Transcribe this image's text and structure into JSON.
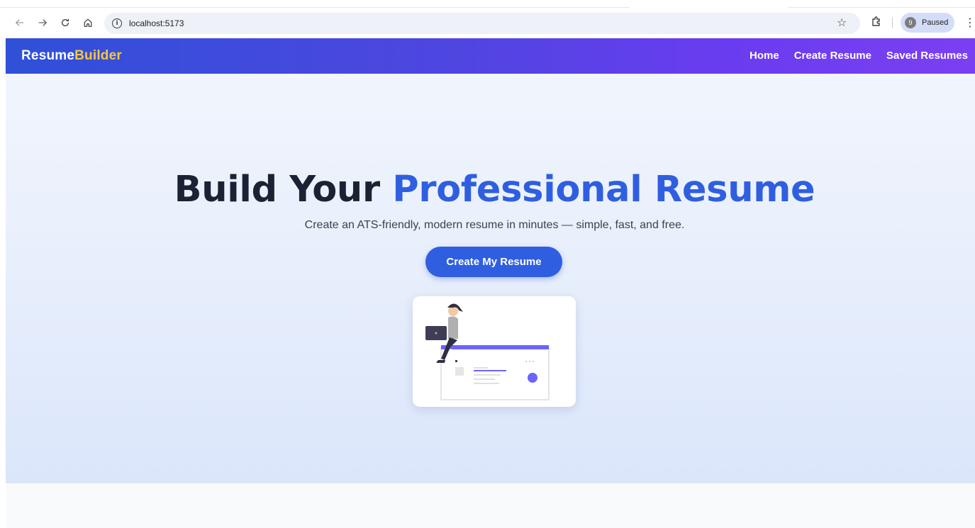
{
  "browser": {
    "url": "localhost:5173",
    "profile_label": "Paused",
    "profile_initial": "9"
  },
  "header": {
    "brand_part1": "Resume",
    "brand_part2": "Builder",
    "nav": [
      {
        "label": "Home"
      },
      {
        "label": "Create Resume"
      },
      {
        "label": "Saved Resumes"
      }
    ]
  },
  "hero": {
    "title_part1": "Build Your ",
    "title_accent": "Professional Resume",
    "subtitle": "Create an ATS-friendly, modern resume in minutes — simple, fast, and free.",
    "cta_label": "Create My Resume"
  },
  "colors": {
    "brand_accent": "#f5c842",
    "primary": "#2f5fe0",
    "header_gradient_start": "#2f50d8",
    "header_gradient_end": "#7b3ff2"
  }
}
